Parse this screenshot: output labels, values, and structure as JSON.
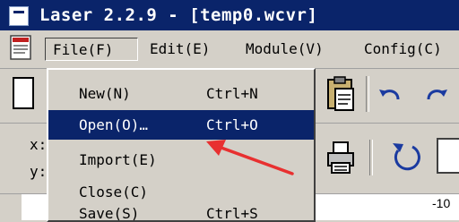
{
  "window": {
    "title": "Laser 2.2.9 - [temp0.wcvr]"
  },
  "menubar": {
    "items": [
      {
        "id": "file",
        "label": "File(F)"
      },
      {
        "id": "edit",
        "label": "Edit(E)"
      },
      {
        "id": "module",
        "label": "Module(V)"
      },
      {
        "id": "config",
        "label": "Config(C)"
      }
    ]
  },
  "file_menu": {
    "items": [
      {
        "label": "New(N)",
        "shortcut": "Ctrl+N",
        "selected": false
      },
      {
        "label": "Open(O)…",
        "shortcut": "Ctrl+O",
        "selected": true
      },
      {
        "label": "Import(E)",
        "shortcut": "",
        "selected": false
      },
      {
        "label": "Close(C)",
        "shortcut": "",
        "selected": false
      },
      {
        "label": "Save(S)",
        "shortcut": "Ctrl+S",
        "selected": false
      }
    ]
  },
  "coords": {
    "x_label": "x:",
    "y_label": "y:"
  },
  "ruler": {
    "label": "-10"
  },
  "icons": {
    "app": "document-icon",
    "newdoc": "new-document-icon",
    "paste": "paste-clipboard-icon",
    "undo": "undo-icon",
    "redo": "redo-icon",
    "printer": "printer-icon",
    "rotate": "rotate-icon",
    "annotation": "red-arrow-icon"
  },
  "colors": {
    "selection": "#0a246a",
    "annotation": "#e83030",
    "face": "#d4d0c8"
  }
}
